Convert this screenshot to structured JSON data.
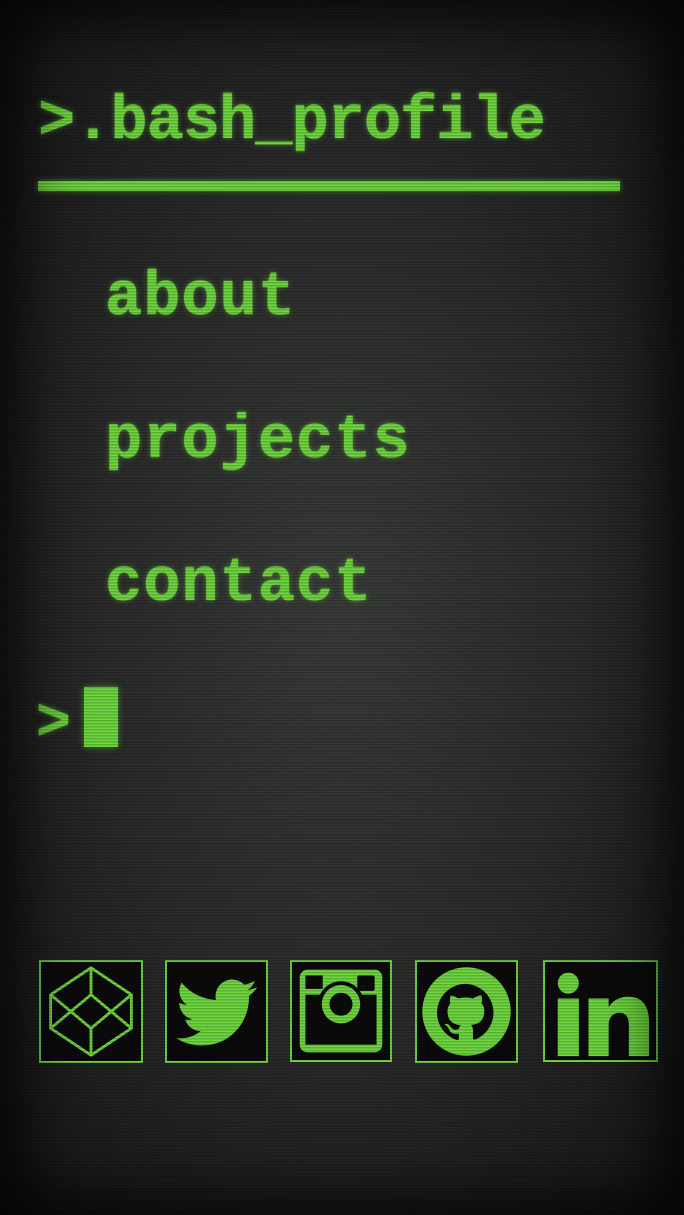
{
  "header": {
    "title": ">.bash_profile"
  },
  "nav": {
    "items": [
      {
        "label": "about"
      },
      {
        "label": "projects"
      },
      {
        "label": "contact"
      }
    ]
  },
  "prompt": {
    "symbol": ">"
  },
  "social": {
    "icons": [
      "codepen-icon",
      "twitter-icon",
      "instagram-icon",
      "github-icon",
      "linkedin-icon"
    ]
  },
  "colors": {
    "accent": "#6fd640",
    "background": "#2c2d2c"
  }
}
